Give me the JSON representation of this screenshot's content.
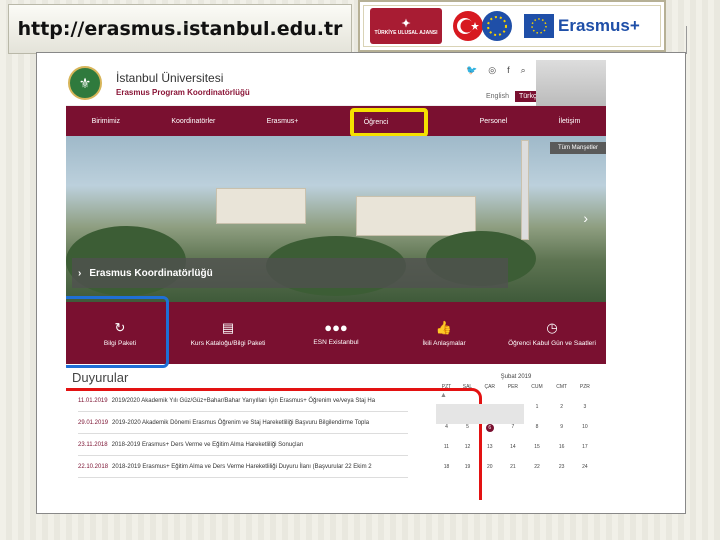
{
  "slide": {
    "url": "http://erasmus.istanbul.edu.tr",
    "logos": {
      "agency": "TÜRKİYE ULUSAL AJANSI",
      "erasmus": "Erasmus+"
    }
  },
  "header": {
    "university": "İstanbul Üniversitesi",
    "office": "Erasmus Program Koordinatörlüğü",
    "social_icons": [
      "twitter-icon",
      "instagram-icon",
      "facebook-icon",
      "search-icon"
    ],
    "lang_en": "English",
    "lang_tr": "Türkçe"
  },
  "nav": [
    "Birimimiz",
    "Koordinatörler",
    "Erasmus+",
    "Öğrenci",
    "Personel",
    "İletişim"
  ],
  "hero": {
    "all_news": "Tüm Manşetler",
    "banner": "Erasmus Koordinatörlüğü"
  },
  "tiles": [
    {
      "label": "Bilgi Paketi",
      "icon": "↻"
    },
    {
      "label": "Kurs Kataloğu/Bilgi Paketi",
      "icon": "▤"
    },
    {
      "label": "ESN Existanbul",
      "icon": "●●●"
    },
    {
      "label": "İkili Anlaşmalar",
      "icon": "👍"
    },
    {
      "label": "Öğrenci Kabul Gün ve Saatleri",
      "icon": "◷"
    }
  ],
  "announcements": {
    "title": "Duyurular",
    "items": [
      {
        "date": "11.01.2019",
        "text": "2019/2020 Akademik Yılı Güz/Güz+Bahar/Bahar Yarıyılları İçin Erasmus+ Öğrenim ve/veya Staj Ha"
      },
      {
        "date": "29.01.2019",
        "text": "2019-2020 Akademik Dönemi Erasmus Öğrenim ve Staj Hareketliliği Başvuru Bilgilendirme Topla"
      },
      {
        "date": "23.11.2018",
        "text": "2018-2019 Erasmus+ Ders Verme ve Eğitim Alma Hareketliliği Sonuçları"
      },
      {
        "date": "22.10.2018",
        "text": "2018-2019 Erasmus+ Eğitim Alma ve Ders Verme Hareketliliği Duyuru İlanı (Başvurular 22 Ekim 2"
      }
    ]
  },
  "calendar": {
    "title": "Şubat 2019",
    "days": [
      "PZT",
      "SAL",
      "ÇAR",
      "PER",
      "CUM",
      "CMT",
      "PZR"
    ],
    "weeks": [
      [
        "",
        "",
        "",
        "",
        "1",
        "2",
        "3"
      ],
      [
        "4",
        "5",
        "6",
        "7",
        "8",
        "9",
        "10"
      ],
      [
        "11",
        "12",
        "13",
        "14",
        "15",
        "16",
        "17"
      ],
      [
        "18",
        "19",
        "20",
        "21",
        "22",
        "23",
        "24"
      ]
    ],
    "highlight": "6"
  }
}
